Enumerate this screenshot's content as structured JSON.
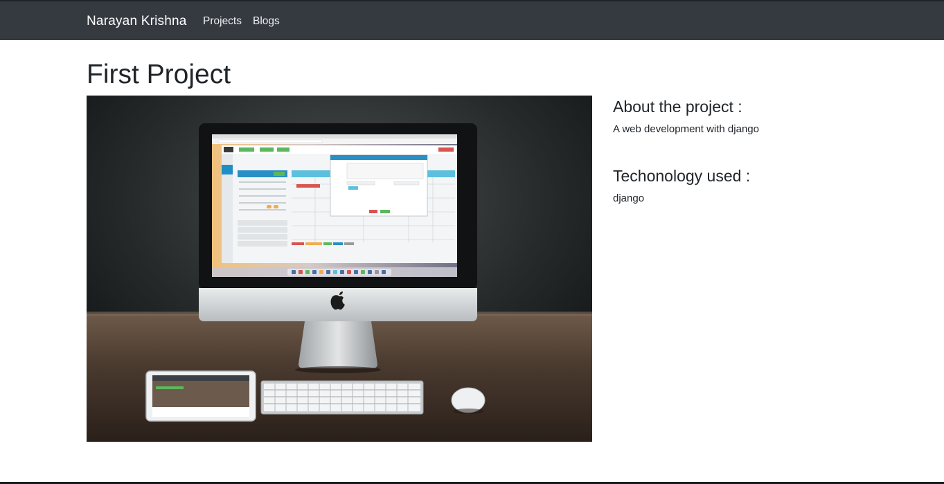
{
  "navbar": {
    "brand": "Narayan Krishna",
    "links": [
      {
        "label": "Projects"
      },
      {
        "label": "Blogs"
      }
    ]
  },
  "project": {
    "title": "First Project",
    "about_heading": "About the project :",
    "about_text": "A web development with django",
    "tech_heading": "Techonology used :",
    "tech_text": "django"
  },
  "colors": {
    "navbar_bg": "#343a40",
    "page_bg": "#ffffff",
    "text": "#212529"
  },
  "icons": [
    "apple-logo-icon"
  ]
}
